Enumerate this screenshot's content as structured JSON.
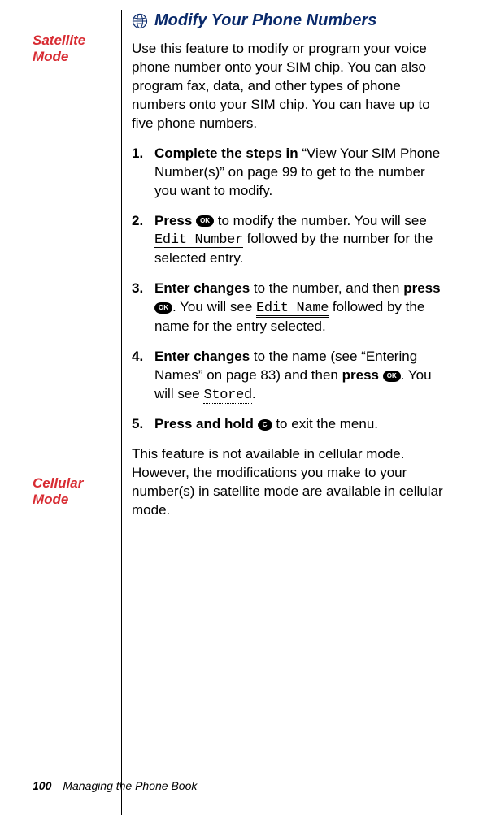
{
  "heading": "Modify Your Phone Numbers",
  "sidebar": {
    "satellite": "Satellite Mode",
    "cellular": "Cellular Mode"
  },
  "intro": "Use this feature to modify or program your voice phone number onto your SIM chip. You can also program fax, data, and other types of phone numbers onto your SIM chip. You can have up to five phone numbers.",
  "steps": {
    "s1a": "Complete the steps in",
    "s1b": " “View Your SIM Phone Number(s)” on page 99 to get to the number you want to modify.",
    "s2a": "Press",
    "s2b": " to modify the number. You will see ",
    "s2c": "Edit Number",
    "s2d": " followed by the number for the selected entry.",
    "s3a": "Enter changes",
    "s3b": " to the number, and then ",
    "s3c": "press",
    "s3d": ". You will see ",
    "s3e": "Edit Name",
    "s3f": " followed by the name for the entry selected.",
    "s4a": "Enter changes",
    "s4b": " to the name (see “Entering Names” on page 83) and then ",
    "s4c": "press",
    "s4d": ". You will see ",
    "s4e": "Stored",
    "s4f": ".",
    "s5a": "Press and hold",
    "s5b": " to exit the menu."
  },
  "cellBody": "This feature is not available in cellular mode. However, the modifications you make to your number(s) in satellite mode are available in cellular mode.",
  "btn": {
    "ok": "OK",
    "c": "C"
  },
  "footer": {
    "page": "100",
    "chapter": "Managing the Phone Book"
  }
}
